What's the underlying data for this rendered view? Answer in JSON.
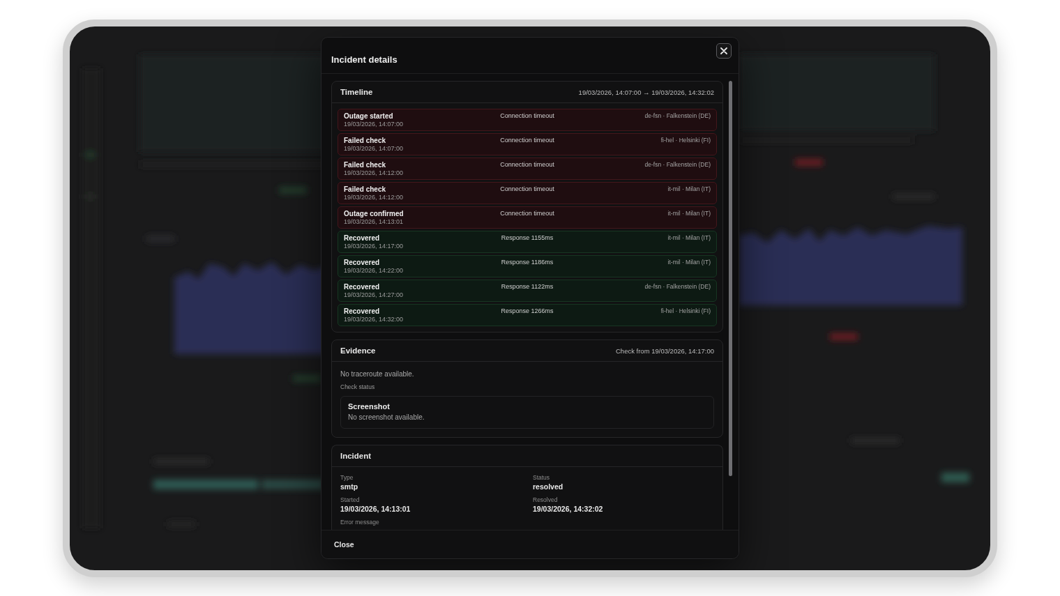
{
  "dialog": {
    "title": "Incident details",
    "timeline": {
      "title": "Timeline",
      "range": "19/03/2026, 14:07:00 → 19/03/2026, 14:32:02",
      "events": [
        {
          "kind": "failure",
          "title": "Outage started",
          "time": "19/03/2026, 14:07:00",
          "detail": "Connection timeout",
          "location": "de-fsn · Falkenstein (DE)"
        },
        {
          "kind": "failure",
          "title": "Failed check",
          "time": "19/03/2026, 14:07:00",
          "detail": "Connection timeout",
          "location": "fi-hel · Helsinki (FI)"
        },
        {
          "kind": "failure",
          "title": "Failed check",
          "time": "19/03/2026, 14:12:00",
          "detail": "Connection timeout",
          "location": "de-fsn · Falkenstein (DE)"
        },
        {
          "kind": "failure",
          "title": "Failed check",
          "time": "19/03/2026, 14:12:00",
          "detail": "Connection timeout",
          "location": "it-mil · Milan (IT)"
        },
        {
          "kind": "failure",
          "title": "Outage confirmed",
          "time": "19/03/2026, 14:13:01",
          "detail": "Connection timeout",
          "location": "it-mil · Milan (IT)"
        },
        {
          "kind": "recovery",
          "title": "Recovered",
          "time": "19/03/2026, 14:17:00",
          "detail": "Response 1155ms",
          "location": "it-mil · Milan (IT)"
        },
        {
          "kind": "recovery",
          "title": "Recovered",
          "time": "19/03/2026, 14:22:00",
          "detail": "Response 1186ms",
          "location": "it-mil · Milan (IT)"
        },
        {
          "kind": "recovery",
          "title": "Recovered",
          "time": "19/03/2026, 14:27:00",
          "detail": "Response 1122ms",
          "location": "de-fsn · Falkenstein (DE)"
        },
        {
          "kind": "recovery",
          "title": "Recovered",
          "time": "19/03/2026, 14:32:00",
          "detail": "Response 1266ms",
          "location": "fi-hel · Helsinki (FI)"
        }
      ]
    },
    "evidence": {
      "title": "Evidence",
      "meta": "Check from 19/03/2026, 14:17:00",
      "traceroute": "No traceroute available.",
      "check_status_label": "Check status",
      "screenshot": {
        "title": "Screenshot",
        "text": "No screenshot available."
      }
    },
    "incident": {
      "title": "Incident",
      "columns": [
        {
          "fields": [
            {
              "label": "Type",
              "value": "smtp"
            },
            {
              "label": "Started",
              "value": "19/03/2026, 14:13:01"
            },
            {
              "label": "Error message"
            }
          ]
        },
        {
          "fields": [
            {
              "label": "Status",
              "value": "resolved"
            },
            {
              "label": "Resolved",
              "value": "19/03/2026, 14:32:02"
            }
          ]
        }
      ]
    },
    "footer": {
      "close_button": "Close"
    }
  }
}
